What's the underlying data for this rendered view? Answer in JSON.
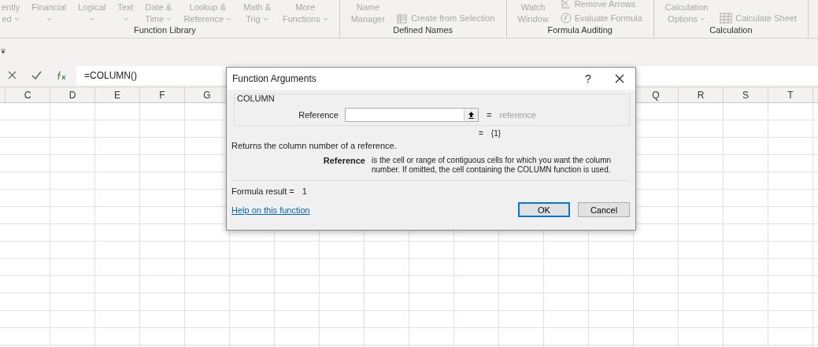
{
  "ribbon": {
    "groups": [
      {
        "label": "Function Library",
        "buttons": [
          {
            "line1": "ently",
            "line2": "ed",
            "caret": true
          },
          {
            "line1": "Financial",
            "caret": true
          },
          {
            "line1": "Logical",
            "caret": true
          },
          {
            "line1": "Text",
            "caret": true
          },
          {
            "line1": "Date &",
            "line2": "Time",
            "caret": true
          },
          {
            "line1": "Lookup &",
            "line2": "Reference",
            "caret": true
          },
          {
            "line1": "Math &",
            "line2": "Trig",
            "caret": true
          },
          {
            "line1": "More",
            "line2": "Functions",
            "caret": true
          }
        ]
      },
      {
        "label": "Defined Names",
        "buttons": [
          {
            "line1": "Name",
            "line2": "Manager",
            "caret": false
          }
        ],
        "small": [
          {
            "label": "Create from Selection",
            "kind": "create"
          }
        ]
      },
      {
        "label": "Formula Auditing",
        "small": [
          {
            "label": "Remove Arrows",
            "kind": "remove"
          },
          {
            "label": "Evaluate Formula",
            "kind": "evaluate"
          }
        ],
        "buttons": [
          {
            "line1": "Watch",
            "line2": "Window",
            "caret": false
          }
        ]
      },
      {
        "label": "Calculation",
        "buttons": [
          {
            "line1": "Calculation",
            "line2": "Options",
            "caret": true
          }
        ],
        "small": [
          {
            "label": "Calculate Sheet",
            "kind": "sheet"
          }
        ]
      }
    ]
  },
  "formula_bar": {
    "formula": "=COLUMN()"
  },
  "columns_left": [
    "C",
    "D",
    "E",
    "F",
    "G"
  ],
  "columns_right": [
    "Q",
    "R",
    "S",
    "T"
  ],
  "dialog": {
    "title": "Function Arguments",
    "help": "?",
    "function_name": "COLUMN",
    "argument": {
      "label": "Reference",
      "equals": "=",
      "hint": "reference"
    },
    "result_equals": "=",
    "result_preview": "{1}",
    "description": "Returns the column number of a reference.",
    "arg_help_label": "Reference",
    "arg_help_text": "is the cell or range of contiguous cells for which you want the column number. If omitted, the cell containing the COLUMN function is used.",
    "formula_result_label": "Formula result =",
    "formula_result": "1",
    "help_link": "Help on this function",
    "ok": "OK",
    "cancel": "Cancel"
  }
}
